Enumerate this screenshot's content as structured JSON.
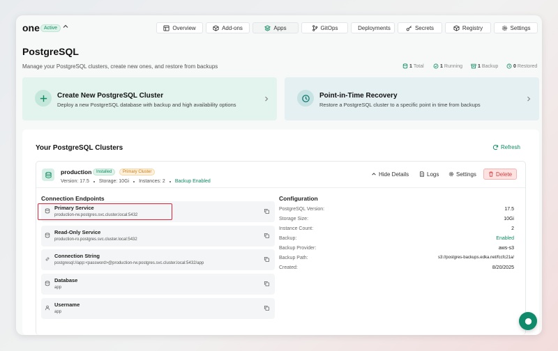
{
  "header": {
    "brand": "one",
    "status_badge": "Active",
    "nav": [
      {
        "label": "Overview",
        "icon": "layout-icon"
      },
      {
        "label": "Add-ons",
        "icon": "package-icon"
      },
      {
        "label": "Apps",
        "icon": "layers-icon"
      },
      {
        "label": "GitOps",
        "icon": "git-branch-icon"
      },
      {
        "label": "Deployments",
        "icon": "rocket-icon"
      },
      {
        "label": "Secrets",
        "icon": "key-icon"
      },
      {
        "label": "Registry",
        "icon": "box-icon"
      },
      {
        "label": "Settings",
        "icon": "gear-icon"
      }
    ]
  },
  "page": {
    "title": "PostgreSQL",
    "description": "Manage your PostgreSQL clusters, create new ones, and restore from backups",
    "stats": [
      {
        "value": "1",
        "label": "Total"
      },
      {
        "value": "1",
        "label": "Running"
      },
      {
        "value": "1",
        "label": "Backup"
      },
      {
        "value": "0",
        "label": "Restored"
      }
    ]
  },
  "actions": {
    "create": {
      "title": "Create New PostgreSQL Cluster",
      "description": "Deploy a new PostgreSQL database with backup and high availability options"
    },
    "recovery": {
      "title": "Point-in-Time Recovery",
      "description": "Restore a PostgreSQL cluster to a specific point in time from backups"
    }
  },
  "clusters": {
    "title": "Your PostgreSQL Clusters",
    "refresh_label": "Refresh",
    "cluster": {
      "name": "production",
      "badges": {
        "installed": "Installed",
        "primary": "Primary Cluster"
      },
      "version": "Version: 17.5",
      "storage": "Storage: 10Gi",
      "instances": "Instances: 2",
      "backup": "Backup Enabled",
      "buttons": {
        "hide_details": "Hide Details",
        "logs": "Logs",
        "settings": "Settings",
        "delete": "Delete"
      }
    },
    "endpoints_title": "Connection Endpoints",
    "endpoints": [
      {
        "label": "Primary Service",
        "value": "production-rw.postgres.svc.cluster.local:5432",
        "icon": "database-icon"
      },
      {
        "label": "Read-Only Service",
        "value": "production-ro.postgres.svc.cluster.local:5432",
        "icon": "database-icon"
      },
      {
        "label": "Connection String",
        "value": "postgresql://app:<password>@production-rw.postgres.svc.cluster.local:5432/app",
        "icon": "link-icon"
      },
      {
        "label": "Database",
        "value": "app",
        "icon": "database-icon"
      },
      {
        "label": "Username",
        "value": "app",
        "icon": "user-icon"
      }
    ],
    "configuration_title": "Configuration",
    "configuration": [
      {
        "label": "PostgreSQL Version:",
        "value": "17.5"
      },
      {
        "label": "Storage Size:",
        "value": "10Gi"
      },
      {
        "label": "Instance Count:",
        "value": "2"
      },
      {
        "label": "Backup:",
        "value": "Enabled"
      },
      {
        "label": "Backup Provider:",
        "value": "aws-s3"
      },
      {
        "label": "Backup Path:",
        "value": "s3://postgres-backups.edka.net/fccfc21a/"
      },
      {
        "label": "Created:",
        "value": "8/20/2025"
      }
    ]
  },
  "colors": {
    "accent": "#0f8a5f",
    "danger": "#d63b3b",
    "highlight": "#e0263a"
  }
}
